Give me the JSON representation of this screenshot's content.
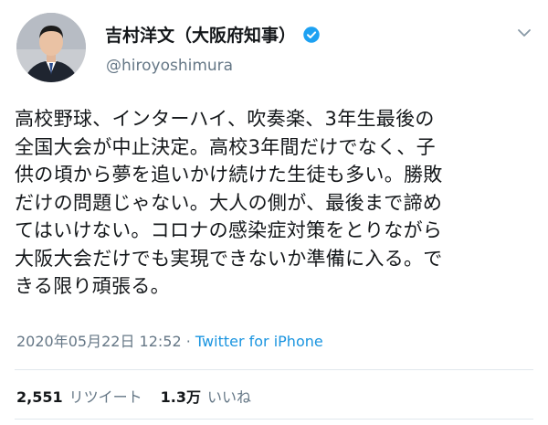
{
  "user": {
    "display_name": "吉村洋文（大阪府知事）",
    "handle": "@hiroyoshimura",
    "verified": true
  },
  "icons": {
    "verified": "verified-badge-icon",
    "menu": "chevron-down-icon",
    "avatar": "profile-photo"
  },
  "tweet": {
    "text_lines": [
      "高校野球、インターハイ、吹奏楽、3年生最後の",
      "全国大会が中止決定。高校3年間だけでなく、子",
      "供の頃から夢を追いかけ続けた生徒も多い。勝敗",
      "だけの問題じゃない。大人の側が、最後まで諦め",
      "てはいけない。コロナの感染症対策をとりながら",
      "大阪大会だけでも実現できないか準備に入る。で",
      "きる限り頑張る。"
    ],
    "timestamp": "2020年05月22日 12:52",
    "separator": " · ",
    "source": "Twitter for iPhone"
  },
  "stats": {
    "retweets_count": "2,551",
    "retweets_label": "リツイート",
    "likes_count": "1.3万",
    "likes_label": "いいね"
  },
  "colors": {
    "text": "#14171a",
    "secondary": "#657786",
    "link": "#1b95e0",
    "verified": "#1da1f2",
    "divider": "#e1e8ed"
  }
}
